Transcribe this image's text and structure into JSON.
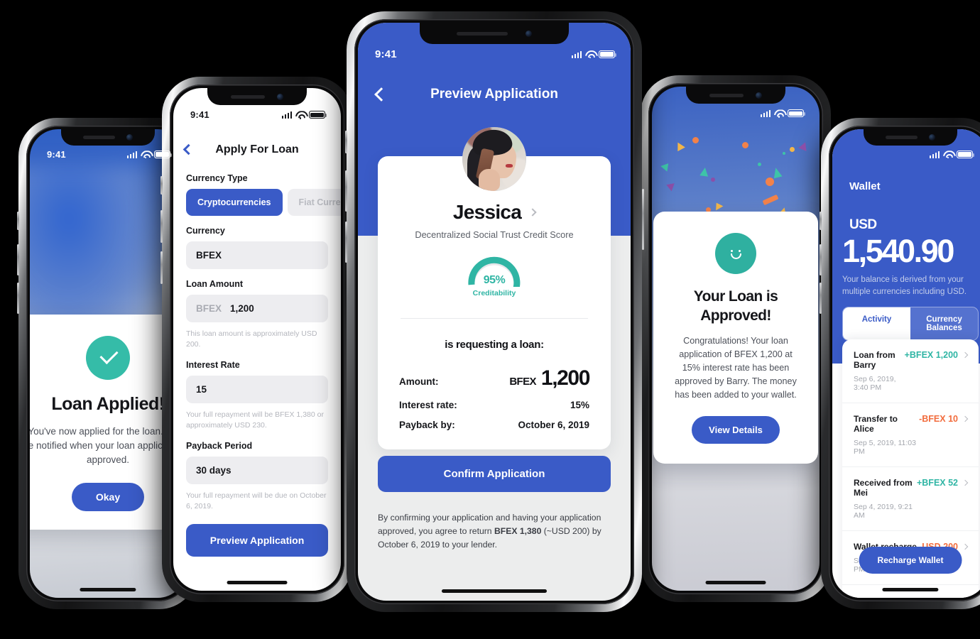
{
  "colors": {
    "brand_blue": "#3a5bc7",
    "teal": "#2fb5a4",
    "orange": "#f26c3d",
    "field_grey": "#ededf0",
    "page_bg": "#000000"
  },
  "status_bar": {
    "time": "9:41",
    "signal": "cellular-signal",
    "wifi": "wifi",
    "battery": "battery-full"
  },
  "phone1": {
    "name": "loan-applied-confirmation",
    "dialog": {
      "icon": "check-circle-icon",
      "title": "Loan Applied!",
      "body": "You've now applied for the loan. You'll be notified when your loan application is approved.",
      "button": "Okay"
    }
  },
  "phone2": {
    "name": "apply-for-loan-form",
    "nav": {
      "back": "chevron-left-icon",
      "title": "Apply For Loan"
    },
    "currency_type": {
      "label": "Currency Type",
      "options": [
        "Cryptocurrencies",
        "Fiat Currencies"
      ],
      "selected": "Cryptocurrencies"
    },
    "currency": {
      "label": "Currency",
      "value": "BFEX"
    },
    "loan_amount": {
      "label": "Loan Amount",
      "prefix": "BFEX",
      "value": "1,200",
      "hint": "This loan amount is approximately USD 200."
    },
    "interest_rate": {
      "label": "Interest Rate",
      "value": "15",
      "hint": "Your full repayment will be BFEX 1,380 or approximately USD 230."
    },
    "payback_period": {
      "label": "Payback Period",
      "value": "30 days",
      "hint": "Your full repayment will be due on October 6, 2019."
    },
    "submit": "Preview Application"
  },
  "phone3": {
    "name": "preview-application",
    "nav": {
      "back": "chevron-left-icon",
      "title": "Preview Application"
    },
    "profile": {
      "avatar": "user-avatar-photo",
      "name": "Jessica",
      "chevron": "chevron-right-icon",
      "subtitle": "Decentralized Social Trust Credit Score",
      "score_pct": "95%",
      "score_value": 95,
      "score_caption": "Creditability"
    },
    "request_heading": "is requesting a loan:",
    "rows": [
      {
        "key": "Amount:",
        "currency": "BFEX",
        "amount": "1,200"
      },
      {
        "key": "Interest rate:",
        "value": "15%"
      },
      {
        "key": "Payback by:",
        "value": "October 6, 2019"
      }
    ],
    "confirm_button": "Confirm Application",
    "legal_parts": {
      "p1": "By confirming your application and having your application approved, you agree to return ",
      "bold": "BFEX 1,380",
      "p2": " (~USD 200) by October 6, 2019 to your lender."
    }
  },
  "phone4": {
    "name": "loan-approved-confirmation",
    "dialog": {
      "icon": "smiley-face-icon",
      "title": "Your Loan is Approved!",
      "body": "Congratulations! Your loan application of BFEX 1,200 at 15% interest rate has been approved by Barry. The money has been added to your wallet.",
      "button": "View Details"
    }
  },
  "phone5": {
    "name": "wallet-screen",
    "title": "Wallet",
    "currency_label": "USD",
    "balance": "1,540.90",
    "note": "Your balance is derived from your multiple currencies including USD.",
    "tabs": {
      "options": [
        "Activity",
        "Currency Balances"
      ],
      "selected": "Currency Balances"
    },
    "transactions": [
      {
        "title": "Loan from Barry",
        "time": "Sep 6, 2019, 3:40 PM",
        "value": "+BFEX 1,200",
        "sign": "pos"
      },
      {
        "title": "Transfer to Alice",
        "time": "Sep 5, 2019, 11:03 PM",
        "value": "-BFEX 10",
        "sign": "neg"
      },
      {
        "title": "Received from Mei",
        "time": "Sep 4, 2019, 9:21 AM",
        "value": "+BFEX 52",
        "sign": "pos"
      },
      {
        "title": "Wallet recharge",
        "time": "Sep 2, 2019, 6:01 PM",
        "value": "-USD 200",
        "sign": "neg"
      }
    ],
    "fab": "Recharge Wallet"
  }
}
